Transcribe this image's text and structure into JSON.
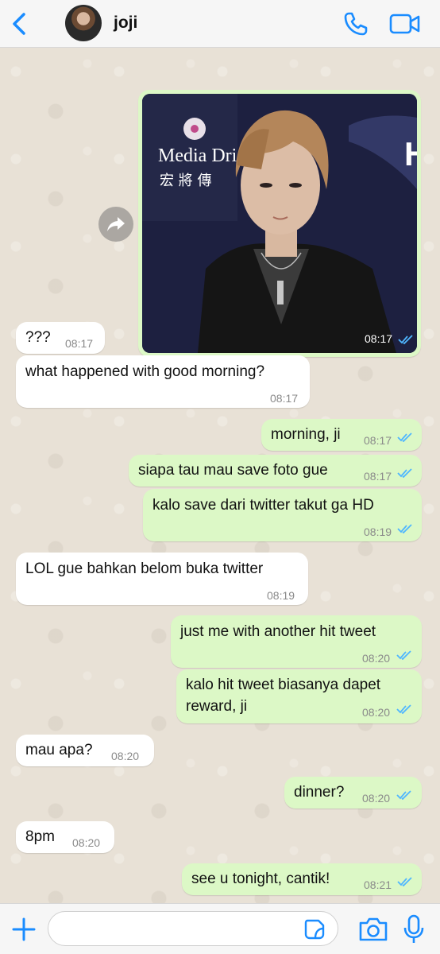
{
  "header": {
    "contact_name": "joji",
    "icons": [
      "back-chevron-icon",
      "avatar",
      "phone-icon",
      "video-camera-icon"
    ]
  },
  "accent_color": "#1a8cff",
  "messages": [
    {
      "dir": "out",
      "type": "photo",
      "time": "08:17",
      "photo_text": {
        "brand": "Media Dri",
        "chinese": "宏 將 傳"
      }
    },
    {
      "dir": "in",
      "text": "???",
      "time": "08:17"
    },
    {
      "dir": "in",
      "text": "what happened with good morning?",
      "time": "08:17"
    },
    {
      "dir": "out",
      "text": "morning, ji",
      "time": "08:17"
    },
    {
      "dir": "out",
      "text": "siapa tau mau save foto gue",
      "time": "08:17"
    },
    {
      "dir": "out",
      "text": "kalo save dari twitter takut ga HD",
      "time": "08:19"
    },
    {
      "dir": "in",
      "text": "LOL gue bahkan belom buka twitter",
      "time": "08:19"
    },
    {
      "dir": "out",
      "text": "just me with another hit tweet",
      "time": "08:20"
    },
    {
      "dir": "out",
      "text": "kalo hit tweet biasanya dapet",
      "text2": "reward, ji",
      "time": "08:20"
    },
    {
      "dir": "in",
      "text": "mau apa?",
      "time": "08:20"
    },
    {
      "dir": "out",
      "text": "dinner?",
      "time": "08:20"
    },
    {
      "dir": "in",
      "text": "8pm",
      "time": "08:20"
    },
    {
      "dir": "out",
      "text": "see u tonight, cantik!",
      "time": "08:21"
    }
  ],
  "composer": {
    "input_value": "",
    "icons": [
      "plus-icon",
      "sticker-icon",
      "camera-icon",
      "microphone-icon"
    ]
  }
}
